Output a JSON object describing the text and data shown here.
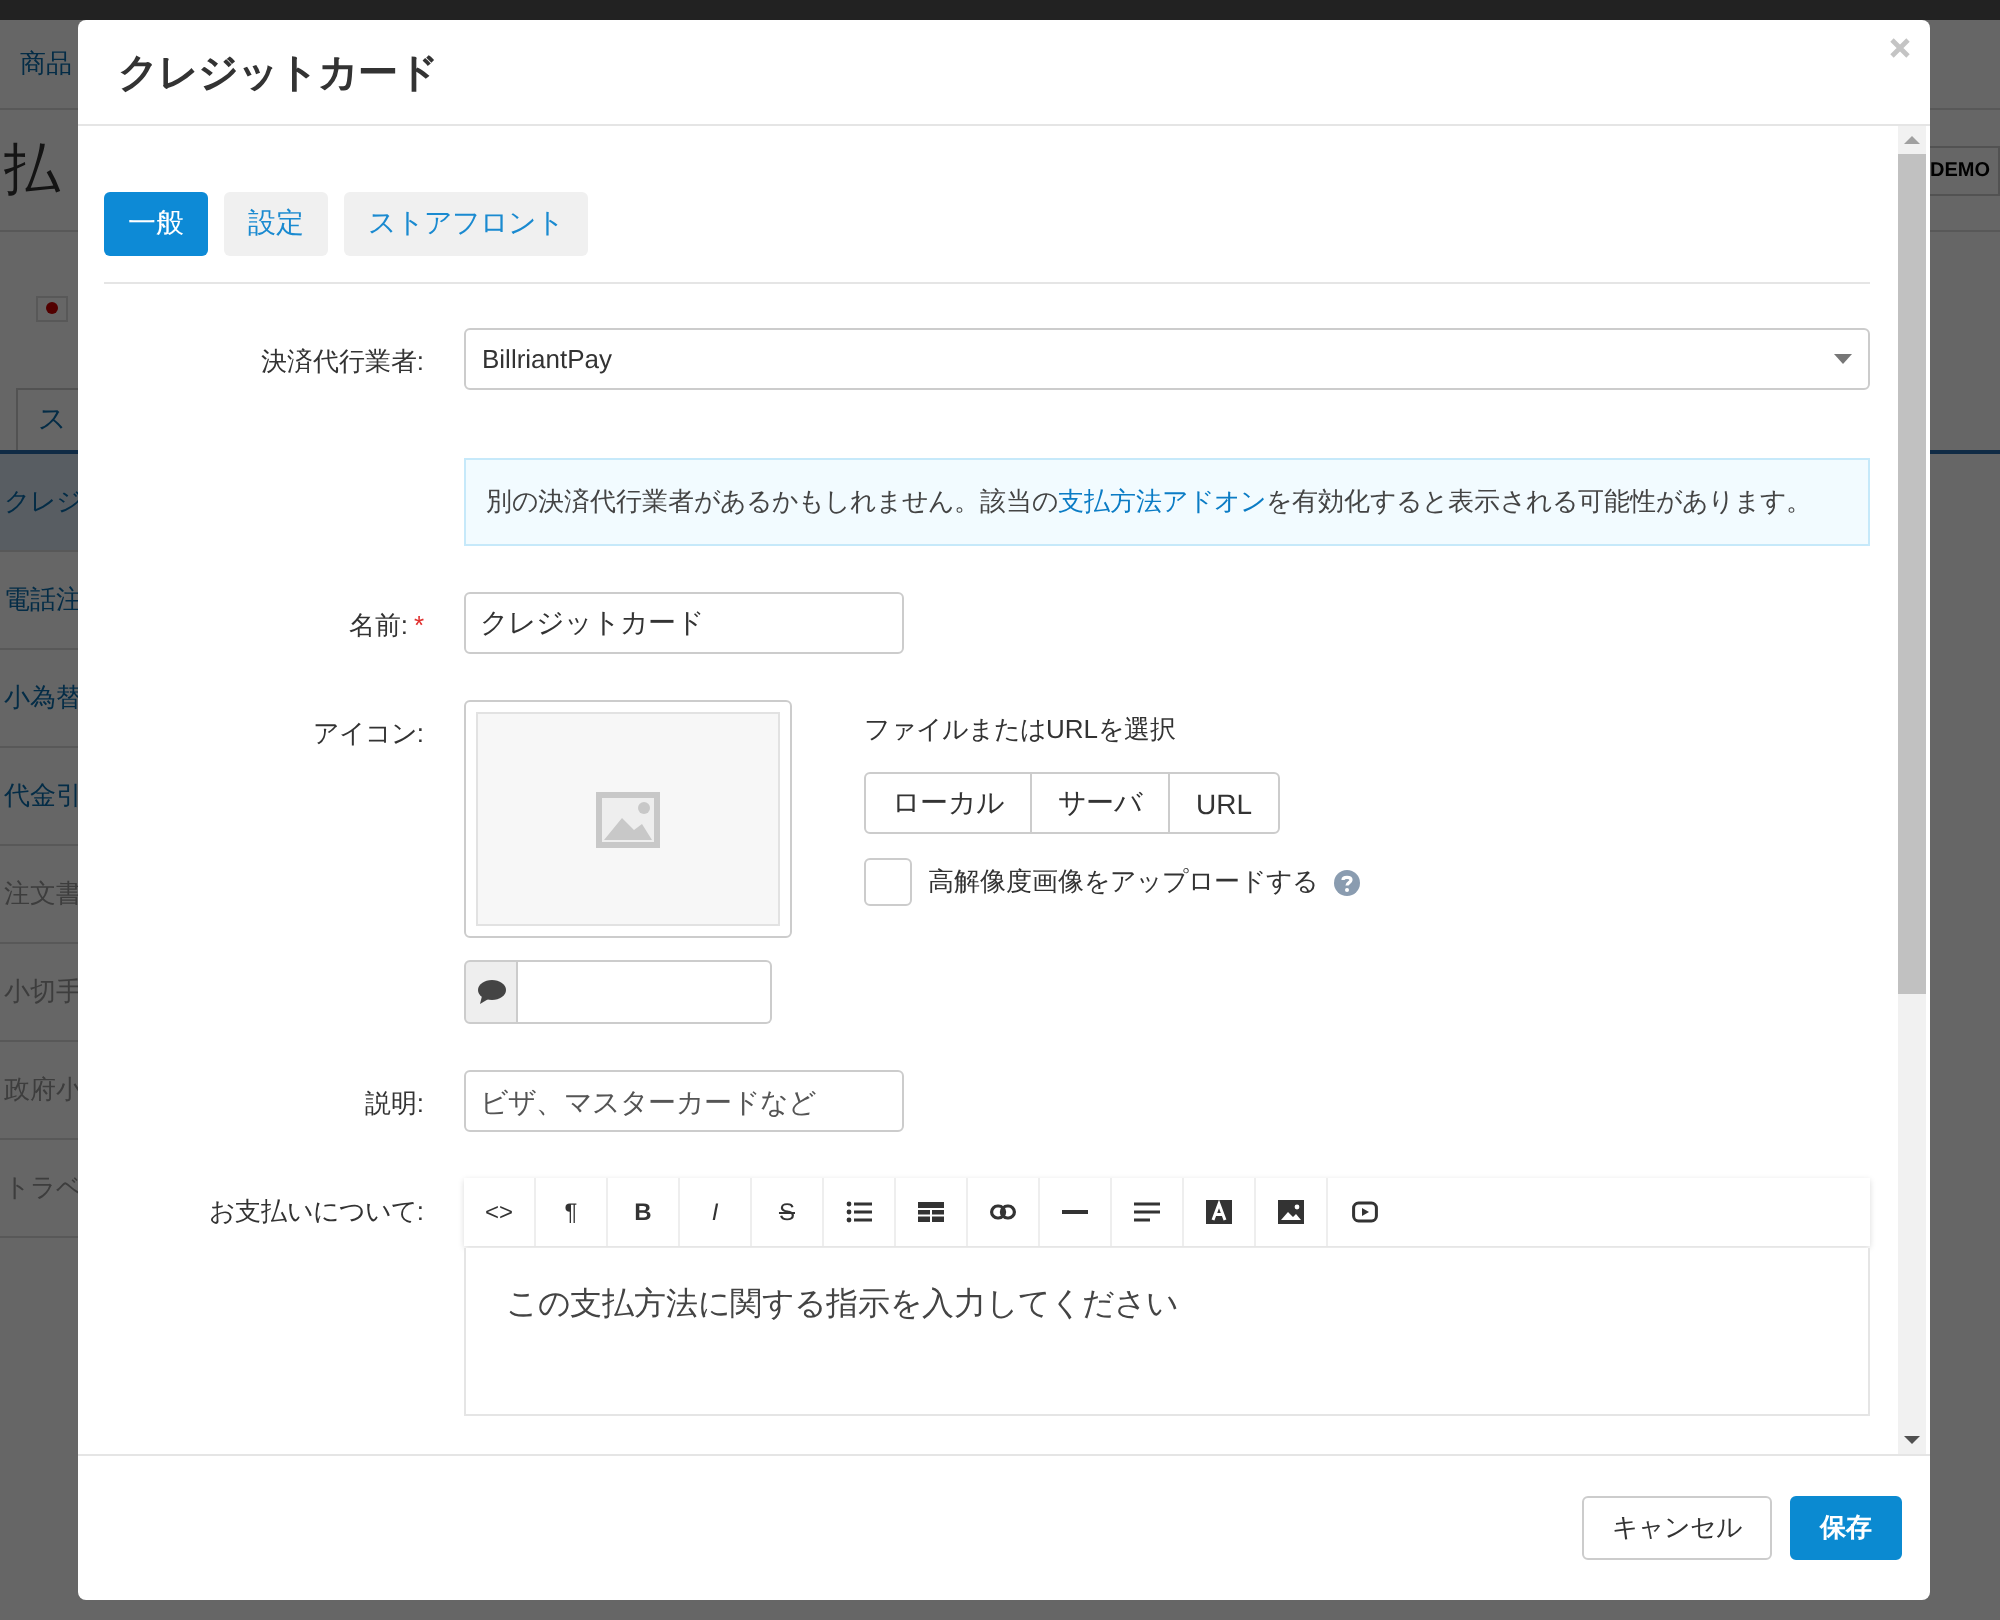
{
  "background": {
    "nav_link": "商品",
    "page_title": "払",
    "badge": "DEMO",
    "tab": "ス",
    "sidebar_items": [
      {
        "label": "クレジ",
        "selected": true,
        "disabled": false
      },
      {
        "label": "電話注",
        "selected": false,
        "disabled": false
      },
      {
        "label": "小為替",
        "selected": false,
        "disabled": false
      },
      {
        "label": "代金引",
        "selected": false,
        "disabled": false
      },
      {
        "label": "注文書",
        "selected": false,
        "disabled": true
      },
      {
        "label": "小切手",
        "selected": false,
        "disabled": true
      },
      {
        "label": "政府小",
        "selected": false,
        "disabled": true
      },
      {
        "label": "トラベ",
        "selected": false,
        "disabled": true
      }
    ]
  },
  "dialog": {
    "title": "クレジットカード",
    "tabs": [
      {
        "label": "一般",
        "selected": true
      },
      {
        "label": "設定",
        "selected": false
      },
      {
        "label": "ストアフロント",
        "selected": false
      }
    ],
    "fields": [
      {
        "kind": "select",
        "label": "決済代行業者:",
        "value": "BillriantPay"
      },
      {
        "kind": "notice",
        "text_before": "別の決済代行業者があるかもしれません。該当の",
        "link": "支払方法アドオン",
        "text_after": "を有効化すると表示される可能性があります。"
      },
      {
        "kind": "text",
        "label": "名前:",
        "required_mark": "*",
        "value": "クレジットカード"
      },
      {
        "kind": "image",
        "label": "アイコン:",
        "source_label": "ファイルまたはURLを選択",
        "sources": [
          "ローカル",
          "サーバ",
          "URL"
        ],
        "hidpi": {
          "label": "高解像度画像をアップロードする",
          "checked": false
        }
      },
      {
        "kind": "text",
        "label": "説明:",
        "placeholder": "ビザ、マスターカードなど"
      },
      {
        "kind": "editor",
        "label": "お支払いについて:",
        "toolbar_glyphs": [
          "<>",
          "¶",
          "B",
          "I",
          "S"
        ],
        "placeholder": "この支払方法に関する指示を入力してください"
      }
    ],
    "buttons": [
      {
        "label": "キャンセル",
        "kind": "secondary"
      },
      {
        "label": "保存",
        "kind": "primary"
      }
    ]
  }
}
